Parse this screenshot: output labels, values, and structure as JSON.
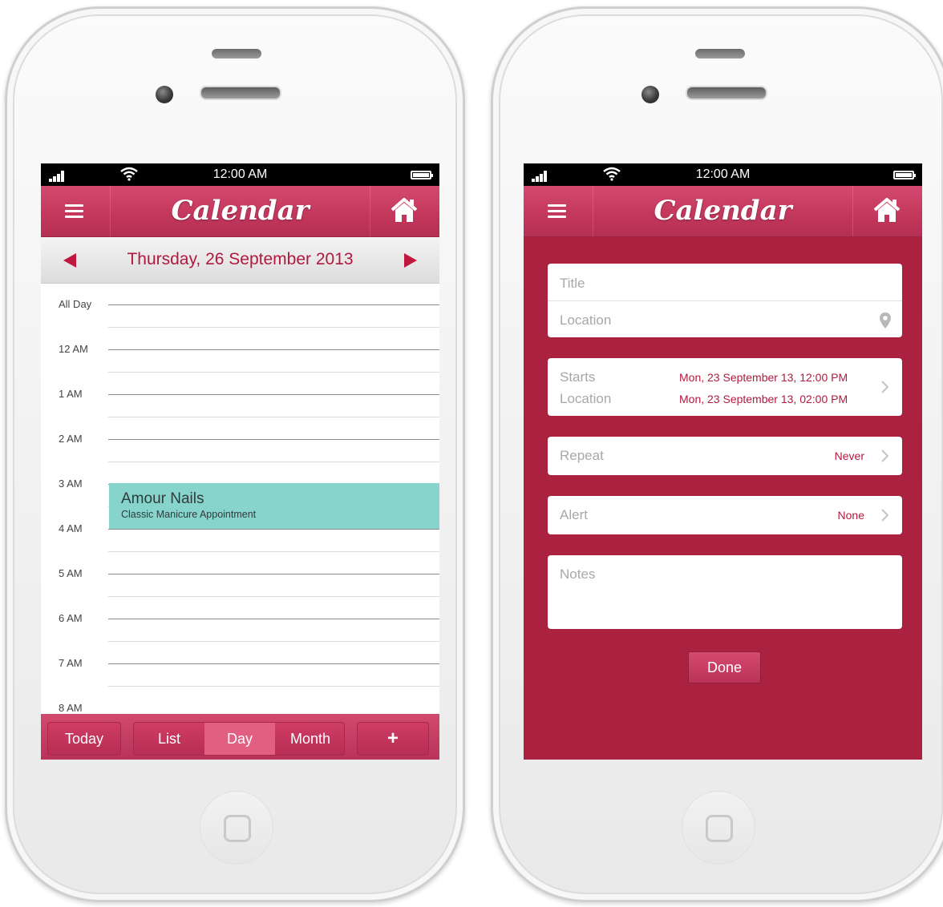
{
  "status_bar": {
    "time": "12:00 AM"
  },
  "app_header": {
    "title": "Calendar"
  },
  "day_view": {
    "date": "Thursday, 26 September 2013",
    "hours": [
      "All Day",
      "12 AM",
      "1 AM",
      "2 AM",
      "3 AM",
      "4 AM",
      "5 AM",
      "6 AM",
      "7 AM",
      "8 AM"
    ],
    "event": {
      "title": "Amour Nails",
      "subtitle": "Classic Manicure Appointment"
    },
    "tabs": {
      "today": "Today",
      "list": "List",
      "day": "Day",
      "month": "Month",
      "add": "+"
    },
    "active_tab": "Day"
  },
  "event_form": {
    "title_placeholder": "Title",
    "location_placeholder": "Location",
    "starts_label": "Starts",
    "starts_value": "Mon, 23 September 13, 12:00 PM",
    "ends_label": "Location",
    "ends_value": "Mon, 23 September 13, 02:00 PM",
    "repeat_label": "Repeat",
    "repeat_value": "Never",
    "alert_label": "Alert",
    "alert_value": "None",
    "notes_label": "Notes",
    "done_label": "Done"
  },
  "colors": {
    "primary": "#c4385d",
    "form_background": "#ab2240",
    "accent_text": "#b4193f",
    "event_fill": "#86d4cc"
  }
}
